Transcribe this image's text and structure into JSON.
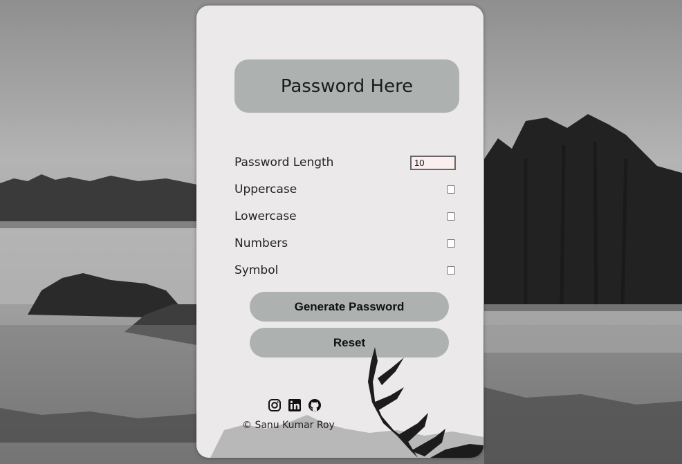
{
  "display": {
    "placeholder": "Password Here"
  },
  "options": {
    "length_label": "Password Length",
    "length_value": "10",
    "uppercase_label": "Uppercase",
    "lowercase_label": "Lowercase",
    "numbers_label": "Numbers",
    "symbol_label": "Symbol"
  },
  "buttons": {
    "generate": "Generate Password",
    "reset": "Reset"
  },
  "social": {
    "icons": [
      "instagram-icon",
      "linkedin-icon",
      "github-icon"
    ]
  },
  "footer": {
    "copyright": "© Sanu Kumar Roy"
  }
}
